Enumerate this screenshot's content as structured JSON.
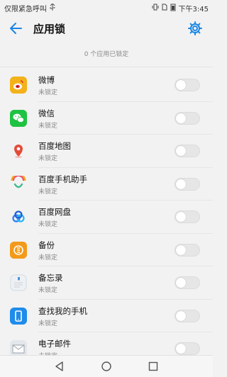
{
  "status_bar": {
    "left_text": "仅限紧急呼叫",
    "time": "下午3:45",
    "icons": [
      "usb-icon",
      "vibrate-icon",
      "sim-icon",
      "battery-icon"
    ]
  },
  "header": {
    "title": "应用锁"
  },
  "summary": {
    "lock_count_text": "0 个应用已锁定"
  },
  "apps": [
    {
      "name": "微博",
      "status": "未锁定",
      "icon": "weibo-icon",
      "locked": false,
      "color": "#f3b21a"
    },
    {
      "name": "微信",
      "status": "未锁定",
      "icon": "wechat-icon",
      "locked": false,
      "color": "#1fc243"
    },
    {
      "name": "百度地图",
      "status": "未锁定",
      "icon": "baidu-map-icon",
      "locked": false,
      "color": "#e34b3a"
    },
    {
      "name": "百度手机助手",
      "status": "未锁定",
      "icon": "baidu-assistant-icon",
      "locked": false,
      "color": "#f5a623"
    },
    {
      "name": "百度网盘",
      "status": "未锁定",
      "icon": "baidu-netdisk-icon",
      "locked": false,
      "color": "#2f7cf6"
    },
    {
      "name": "备份",
      "status": "未锁定",
      "icon": "backup-icon",
      "locked": false,
      "color": "#f39a1a"
    },
    {
      "name": "备忘录",
      "status": "未锁定",
      "icon": "memo-icon",
      "locked": false,
      "color": "#e9eef2"
    },
    {
      "name": "查找我的手机",
      "status": "未锁定",
      "icon": "find-phone-icon",
      "locked": false,
      "color": "#1f8cea"
    },
    {
      "name": "电子邮件",
      "status": "未锁定",
      "icon": "email-icon",
      "locked": false,
      "color": "#d9dde2"
    }
  ],
  "colors": {
    "accent": "#1a87e5",
    "background": "#f2f2f2"
  }
}
